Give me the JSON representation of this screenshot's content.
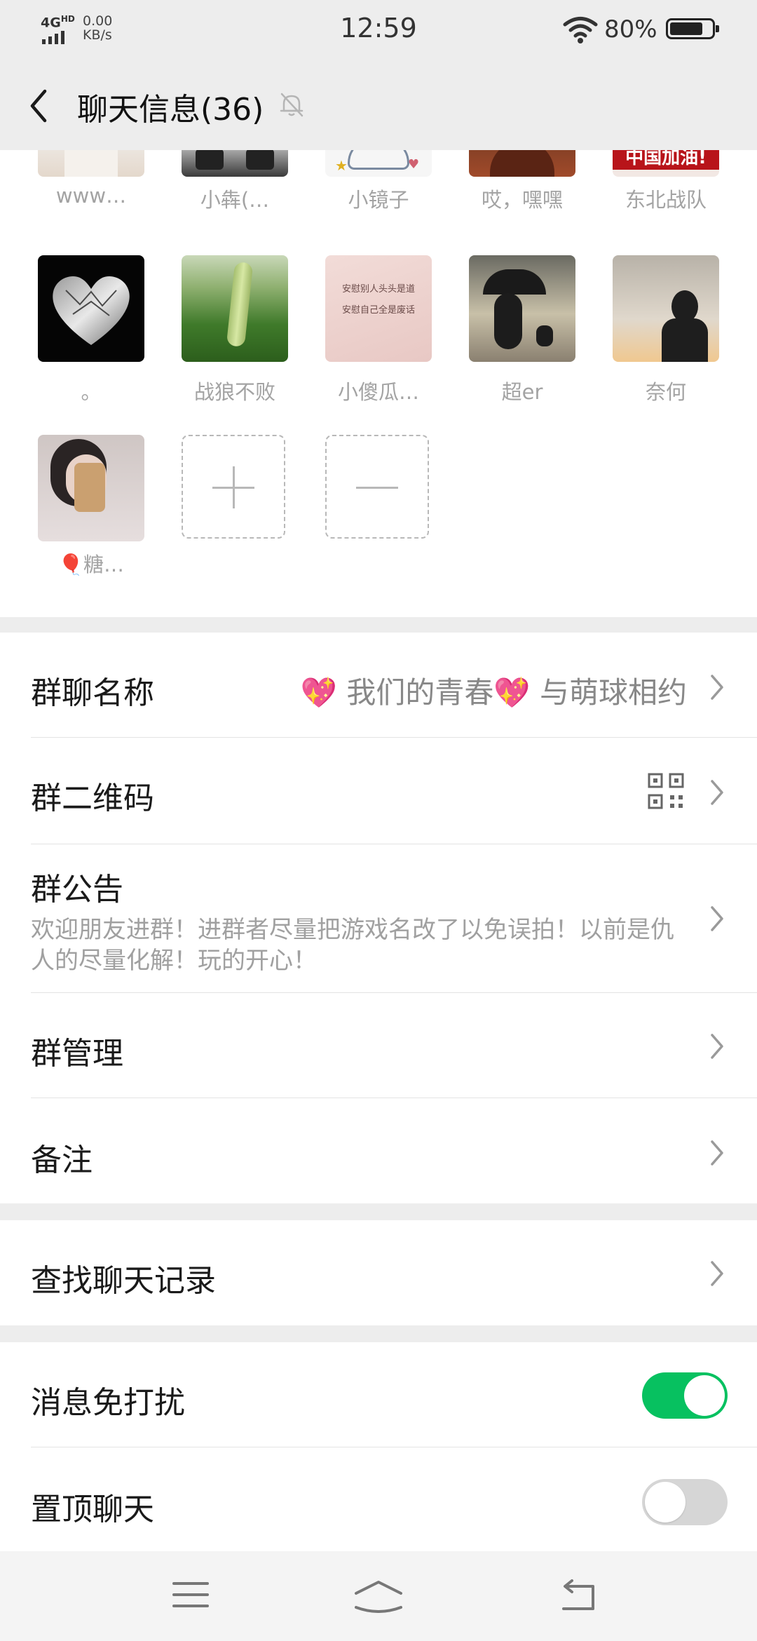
{
  "status_bar": {
    "network": "4G",
    "network_sup": "HD",
    "speed_value": "0.00",
    "speed_unit": "KB/s",
    "time": "12:59",
    "battery_percent": "80%",
    "battery_level": 0.8
  },
  "header": {
    "title": "聊天信息(36)",
    "mute_icon": "bell-off-icon",
    "back_icon": "back-arrow-icon"
  },
  "members": [
    {
      "name": "www…"
    },
    {
      "name": "小犇(…"
    },
    {
      "name": "小镜子"
    },
    {
      "name": "哎，嘿嘿"
    },
    {
      "name": "东北战队",
      "avatar_text": "中国加油!"
    },
    {
      "name": "。"
    },
    {
      "name": "战狼不败"
    },
    {
      "name": "小傻瓜…",
      "avatar_text_1": "安慰别人头头是道",
      "avatar_text_2": "安慰自己全是废话"
    },
    {
      "name": "超er"
    },
    {
      "name": "奈何"
    },
    {
      "name": "🎈糖…"
    }
  ],
  "member_actions": {
    "add_icon": "plus-icon",
    "remove_icon": "minus-icon"
  },
  "settings": {
    "group_name_label": "群聊名称",
    "group_name_value": "💖 我们的青春💖 与萌球相约",
    "qrcode_label": "群二维码",
    "qrcode_icon": "qr-code-icon",
    "notice_label": "群公告",
    "notice_text": "欢迎朋友进群！进群者尽量把游戏名改了以免误拍！以前是仇人的尽量化解！玩的开心！",
    "manage_label": "群管理",
    "remark_label": "备注",
    "search_label": "查找聊天记录",
    "mute_label": "消息免打扰",
    "mute_on": true,
    "pin_label": "置顶聊天",
    "pin_on": false
  },
  "colors": {
    "accent": "#07c160",
    "background": "#ededed",
    "secondary_text": "#a3a3a3"
  }
}
